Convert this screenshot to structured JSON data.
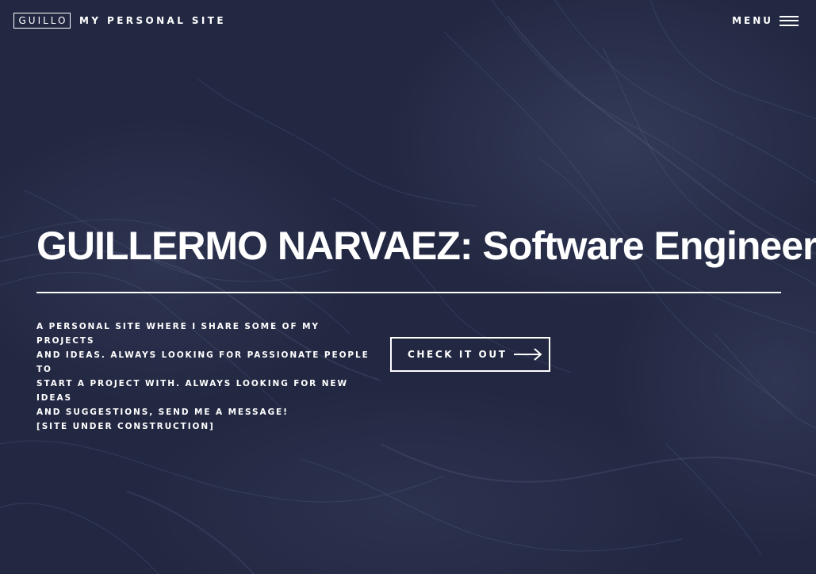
{
  "header": {
    "logo": "GUILLO",
    "site_title": "MY PERSONAL SITE",
    "menu_label": "MENU",
    "menu_icon": "hamburger-icon"
  },
  "hero": {
    "title": "GUILLERMO NARVAEZ: Software Engineer",
    "description_lines": [
      "A PERSONAL SITE WHERE I SHARE SOME OF MY PROJECTS",
      "AND IDEAS. ALWAYS LOOKING FOR PASSIONATE PEOPLE TO",
      "START A PROJECT WITH. ALWAYS LOOKING FOR NEW IDEAS",
      "AND SUGGESTIONS, SEND ME A MESSAGE!",
      "[SITE UNDER CONSTRUCTION]"
    ],
    "cta_label": "CHECK IT OUT",
    "cta_icon": "arrow-right-icon"
  },
  "colors": {
    "background": "#232842",
    "text": "#ffffff",
    "texture": "#6f7da8"
  }
}
